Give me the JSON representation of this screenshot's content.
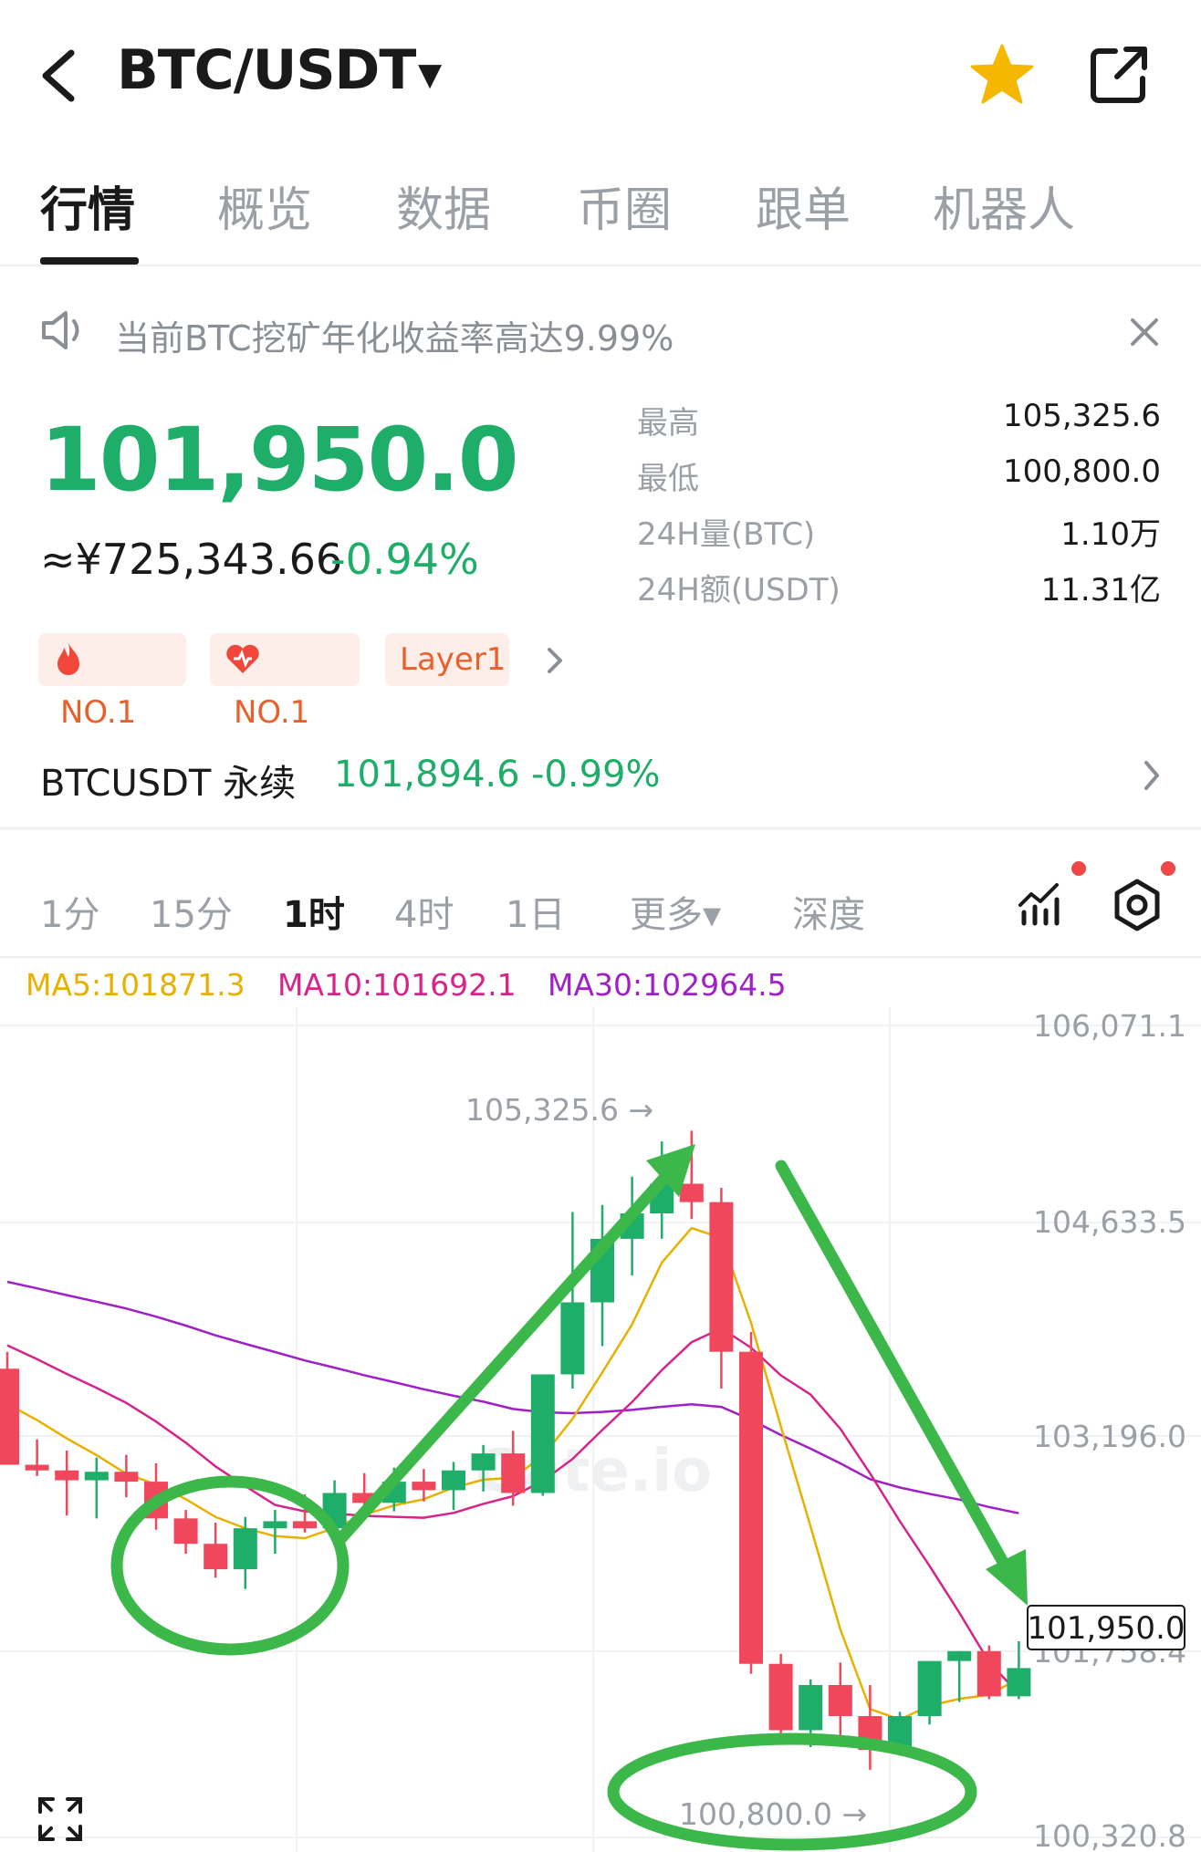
{
  "header": {
    "pair": "BTC/USDT",
    "icons": {
      "back": "chevron-left-icon",
      "dropdown": "caret-down-icon",
      "favorite": "star-icon",
      "share": "external-link-icon"
    },
    "colors": {
      "star": "#f5b800"
    }
  },
  "tabs": [
    {
      "label": "行情",
      "active": true
    },
    {
      "label": "概览"
    },
    {
      "label": "数据"
    },
    {
      "label": "币圈"
    },
    {
      "label": "跟单"
    },
    {
      "label": "机器人"
    }
  ],
  "notice": {
    "text": "当前BTC挖矿年化收益率高达9.99%",
    "icon": "speaker-icon",
    "close_icon": "close-icon"
  },
  "price": {
    "last": "101,950.0",
    "cny": "≈¥725,343.66",
    "change": "-0.94%",
    "color": "#1fae6a"
  },
  "stats": [
    {
      "label": "最高",
      "value": "105,325.6"
    },
    {
      "label": "最低",
      "value": "100,800.0"
    },
    {
      "label": "24H量(BTC)",
      "value": "1.10万"
    },
    {
      "label": "24H额(USDT)",
      "value": "11.31亿"
    }
  ],
  "badges": [
    {
      "icon": "flame-icon",
      "label": "NO.1"
    },
    {
      "icon": "heart-icon",
      "label": "NO.1"
    },
    {
      "label": "Layer1"
    }
  ],
  "perpetual": {
    "name": "BTCUSDT 永续",
    "price": "101,894.6",
    "change": "-0.99%"
  },
  "intervals": [
    {
      "label": "1分"
    },
    {
      "label": "15分"
    },
    {
      "label": "1时",
      "active": true
    },
    {
      "label": "4时"
    },
    {
      "label": "1日"
    },
    {
      "label": "更多▾"
    },
    {
      "label": "深度"
    }
  ],
  "chart_tools": {
    "indicator_icon": "indicator-chart-icon",
    "settings_icon": "settings-hexagon-icon",
    "expand_icon": "expand-icon"
  },
  "ma": [
    {
      "label": "MA5:101871.3",
      "color": "#e8b100"
    },
    {
      "label": "MA10:101692.1",
      "color": "#d6248a"
    },
    {
      "label": "MA30:102964.5",
      "color": "#a020c8"
    }
  ],
  "chart_data": {
    "type": "candlestick",
    "y_axis_labels": [
      "106,071.1",
      "104,633.5",
      "103,196.0",
      "101,758.4",
      "100,320.8"
    ],
    "current_price_label": "101,950.0",
    "high_marker": "105,325.6 →",
    "low_marker": "100,800.0 →",
    "watermark": "Gate.io",
    "colors": {
      "up": "#1fae6a",
      "down": "#f0475c",
      "annotation": "#3cb84a"
    },
    "candles": [
      {
        "o": 103640,
        "h": 103760,
        "l": 102960,
        "c": 102960
      },
      {
        "o": 102960,
        "h": 103140,
        "l": 102880,
        "c": 102920
      },
      {
        "o": 102920,
        "h": 103060,
        "l": 102600,
        "c": 102850
      },
      {
        "o": 102850,
        "h": 103010,
        "l": 102580,
        "c": 102910
      },
      {
        "o": 102910,
        "h": 103030,
        "l": 102730,
        "c": 102840
      },
      {
        "o": 102840,
        "h": 102970,
        "l": 102500,
        "c": 102580
      },
      {
        "o": 102580,
        "h": 102640,
        "l": 102330,
        "c": 102400
      },
      {
        "o": 102400,
        "h": 102550,
        "l": 102160,
        "c": 102220
      },
      {
        "o": 102220,
        "h": 102590,
        "l": 102080,
        "c": 102510
      },
      {
        "o": 102510,
        "h": 102640,
        "l": 102330,
        "c": 102560
      },
      {
        "o": 102560,
        "h": 102750,
        "l": 102480,
        "c": 102510
      },
      {
        "o": 102510,
        "h": 102850,
        "l": 102480,
        "c": 102760
      },
      {
        "o": 102760,
        "h": 102900,
        "l": 102620,
        "c": 102690
      },
      {
        "o": 102690,
        "h": 102940,
        "l": 102630,
        "c": 102840
      },
      {
        "o": 102840,
        "h": 102930,
        "l": 102700,
        "c": 102780
      },
      {
        "o": 102780,
        "h": 102980,
        "l": 102640,
        "c": 102920
      },
      {
        "o": 102920,
        "h": 103100,
        "l": 102770,
        "c": 103040
      },
      {
        "o": 103040,
        "h": 103200,
        "l": 102670,
        "c": 102760
      },
      {
        "o": 102760,
        "h": 103050,
        "l": 102740,
        "c": 103600
      },
      {
        "o": 103600,
        "h": 104750,
        "l": 103500,
        "c": 104110
      },
      {
        "o": 104110,
        "h": 104800,
        "l": 103800,
        "c": 104560
      },
      {
        "o": 104560,
        "h": 105000,
        "l": 104300,
        "c": 104740
      },
      {
        "o": 104740,
        "h": 105250,
        "l": 104560,
        "c": 104950
      },
      {
        "o": 104950,
        "h": 105325.6,
        "l": 104700,
        "c": 104820
      },
      {
        "o": 104820,
        "h": 104920,
        "l": 103500,
        "c": 103760
      },
      {
        "o": 103760,
        "h": 103900,
        "l": 101480,
        "c": 101550
      },
      {
        "o": 101550,
        "h": 101620,
        "l": 100980,
        "c": 101080
      },
      {
        "o": 101080,
        "h": 101440,
        "l": 100960,
        "c": 101400
      },
      {
        "o": 101400,
        "h": 101560,
        "l": 101000,
        "c": 101180
      },
      {
        "o": 101180,
        "h": 101400,
        "l": 100800,
        "c": 100940
      },
      {
        "o": 100940,
        "h": 101210,
        "l": 100900,
        "c": 101180
      },
      {
        "o": 101180,
        "h": 101560,
        "l": 101120,
        "c": 101570
      },
      {
        "o": 101570,
        "h": 101640,
        "l": 101280,
        "c": 101640
      },
      {
        "o": 101640,
        "h": 101680,
        "l": 101300,
        "c": 101320
      },
      {
        "o": 101320,
        "h": 101710,
        "l": 101300,
        "c": 101520
      }
    ]
  }
}
